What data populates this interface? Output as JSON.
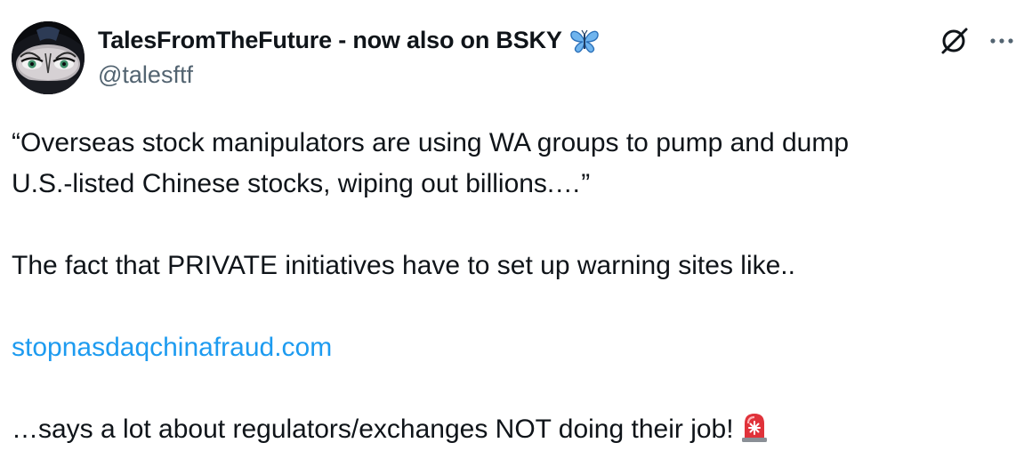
{
  "author": {
    "display_name": "TalesFromTheFuture - now also on BSKY",
    "handle": "@talesftf",
    "name_emoji": "butterfly-icon"
  },
  "header_actions": {
    "grok_icon": "grok-icon",
    "more_icon": "more-icon"
  },
  "tweet": {
    "line1": "“Overseas stock manipulators are using WA groups to pump and dump",
    "line2": "U.S.-listed Chinese stocks, wiping out billions.…”",
    "line3": "The fact that PRIVATE initiatives have to set up warning sites like..",
    "link": "stopnasdaqchinafraud.com",
    "line4": "…says a lot about regulators/exchanges NOT doing their job!",
    "end_emoji": "siren-icon"
  },
  "colors": {
    "text": "#0f1419",
    "secondary": "#536471",
    "link": "#1d9bf0",
    "butterfly": "#4a9fe8",
    "siren": "#e0323a"
  }
}
